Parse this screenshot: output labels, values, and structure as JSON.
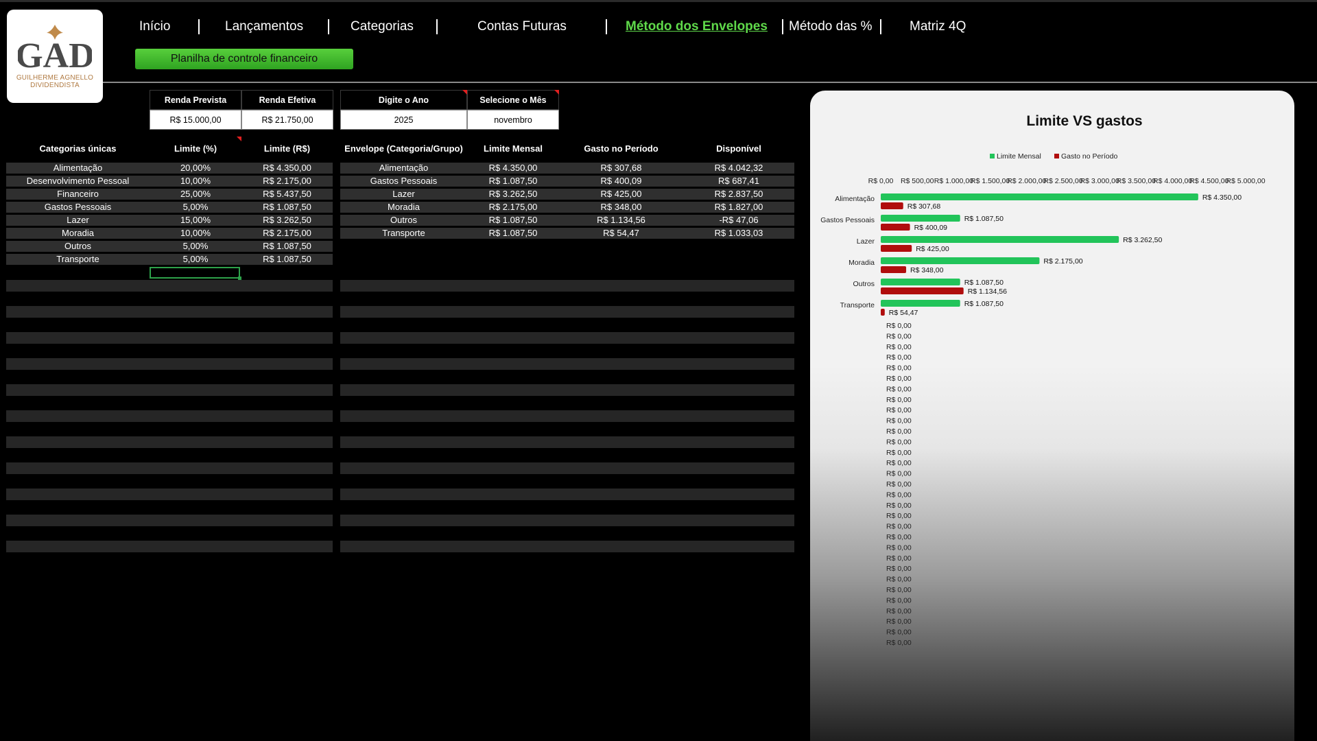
{
  "nav": {
    "items": [
      "Início",
      "Lançamentos",
      "Categorias",
      "Contas Futuras",
      "Método dos Envelopes",
      "Método das %",
      "Matriz 4Q"
    ],
    "active": "Método dos Envelopes"
  },
  "subtitle": "Planilha de controle financeiro",
  "logo": {
    "mark": "GAD",
    "line1": "GUILHERME AGNELLO",
    "line2": "DIVIDENDISTA"
  },
  "income": {
    "planned_label": "Renda Prevista",
    "actual_label": "Renda Efetiva",
    "planned": "R$ 15.000,00",
    "actual": "R$ 21.750,00"
  },
  "period": {
    "year_label": "Digite o Ano",
    "month_label": "Selecione o Mês",
    "year": "2025",
    "month": "novembro"
  },
  "categories_table": {
    "headers": [
      "Categorias únicas",
      "Limite (%)",
      "Limite (R$)"
    ],
    "rows": [
      [
        "Alimentação",
        "20,00%",
        "R$ 4.350,00"
      ],
      [
        "Desenvolvimento Pessoal",
        "10,00%",
        "R$ 2.175,00"
      ],
      [
        "Financeiro",
        "25,00%",
        "R$ 5.437,50"
      ],
      [
        "Gastos Pessoais",
        "5,00%",
        "R$ 1.087,50"
      ],
      [
        "Lazer",
        "15,00%",
        "R$ 3.262,50"
      ],
      [
        "Moradia",
        "10,00%",
        "R$ 2.175,00"
      ],
      [
        "Outros",
        "5,00%",
        "R$ 1.087,50"
      ],
      [
        "Transporte",
        "5,00%",
        "R$ 1.087,50"
      ]
    ]
  },
  "envelope_table": {
    "headers": [
      "Envelope (Categoria/Grupo)",
      "Limite Mensal",
      "Gasto no Período",
      "Disponível"
    ],
    "rows": [
      [
        "Alimentação",
        "R$ 4.350,00",
        "R$ 307,68",
        "R$ 4.042,32"
      ],
      [
        "Gastos Pessoais",
        "R$ 1.087,50",
        "R$ 400,09",
        "R$ 687,41"
      ],
      [
        "Lazer",
        "R$ 3.262,50",
        "R$ 425,00",
        "R$ 2.837,50"
      ],
      [
        "Moradia",
        "R$ 2.175,00",
        "R$ 348,00",
        "R$ 1.827,00"
      ],
      [
        "Outros",
        "R$ 1.087,50",
        "R$ 1.134,56",
        "-R$ 47,06"
      ],
      [
        "Transporte",
        "R$ 1.087,50",
        "R$ 54,47",
        "R$ 1.033,03"
      ]
    ]
  },
  "colors": {
    "accent_green": "#5fd94a",
    "bar_limit": "#22c45a",
    "bar_spent": "#b00d0d",
    "row_bg": "#2f2f2f"
  },
  "chart_data": {
    "type": "bar",
    "orientation": "horizontal",
    "title": "Limite VS gastos",
    "legend_position": "top",
    "categories": [
      "Alimentação",
      "Gastos Pessoais",
      "Lazer",
      "Moradia",
      "Outros",
      "Transporte"
    ],
    "series": [
      {
        "name": "Limite Mensal",
        "color": "#22c45a",
        "values": [
          4350.0,
          1087.5,
          3262.5,
          2175.0,
          1087.5,
          1087.5
        ],
        "labels": [
          "R$ 4.350,00",
          "R$ 1.087,50",
          "R$ 3.262,50",
          "R$ 2.175,00",
          "R$ 1.087,50",
          "R$ 1.087,50"
        ]
      },
      {
        "name": "Gasto no Período",
        "color": "#b00d0d",
        "values": [
          307.68,
          400.09,
          425.0,
          348.0,
          1134.56,
          54.47
        ],
        "labels": [
          "R$ 307,68",
          "R$ 400,09",
          "R$ 425,00",
          "R$ 348,00",
          "R$ 1.134,56",
          "R$ 54,47"
        ]
      }
    ],
    "xlim": [
      0,
      5000
    ],
    "x_ticks": [
      "R$ 0,00",
      "R$ 500,00",
      "R$ 1.000,00",
      "R$ 1.500,00",
      "R$ 2.000,00",
      "R$ 2.500,00",
      "R$ 3.000,00",
      "R$ 3.500,00",
      "R$ 4.000,00",
      "R$ 4.500,00",
      "R$ 5.000,00"
    ],
    "x_tick_values": [
      0,
      500,
      1000,
      1500,
      2000,
      2500,
      3000,
      3500,
      4000,
      4500,
      5000
    ],
    "empty_label": "R$ 0,00",
    "empty_label_count": 31,
    "grid": false
  }
}
